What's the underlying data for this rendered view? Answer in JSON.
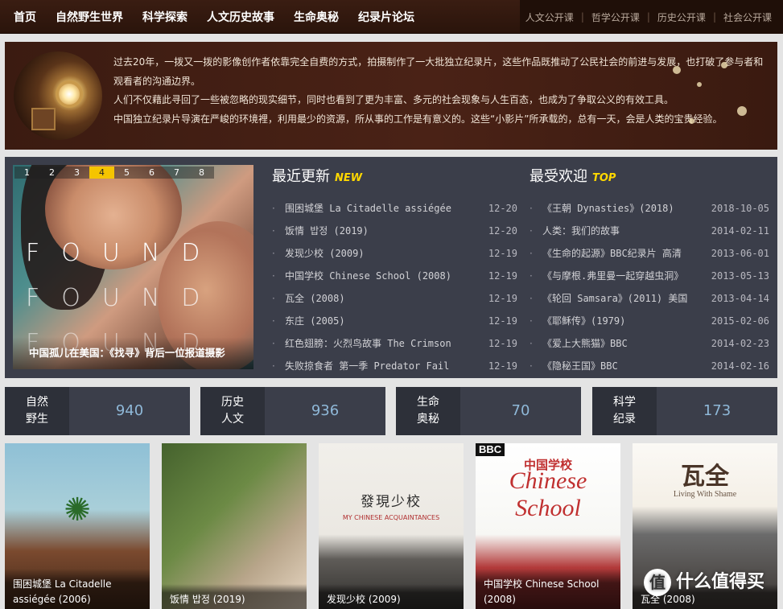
{
  "nav": {
    "main": [
      "首页",
      "自然野生世界",
      "科学探索",
      "人文历史故事",
      "生命奥秘",
      "纪录片论坛"
    ],
    "sub": [
      "人文公开课",
      "哲学公开课",
      "历史公开课",
      "社会公开课"
    ]
  },
  "intro": {
    "paragraphs": [
      "过去20年，一拨又一拨的影像创作者依靠完全自费的方式，拍摄制作了一大批独立纪录片，这些作品既推动了公民社会的前进与发展，也打破了参与者和观看者的沟通边界。",
      "人们不仅藉此寻回了一些被忽略的现实细节，同时也看到了更为丰富、多元的社会现象与人生百态，也成为了争取公义的有效工具。",
      "中国独立纪录片导演在严峻的环境裡，利用最少的资源，所从事的工作是有意义的。这些“小影片”所承载的，总有一天，会是人类的宝贵经验。"
    ]
  },
  "slider": {
    "pages": [
      "1",
      "2",
      "3",
      "4",
      "5",
      "6",
      "7",
      "8"
    ],
    "active_page": "4",
    "overlay_words": [
      "FOUND",
      "FOUND",
      "FOUND"
    ],
    "caption": "中国孤儿在美国：《找寻》背后一位报道摄影"
  },
  "latest": {
    "title": "最近更新",
    "tag": "NEW",
    "items": [
      {
        "title": "围困城堡 La Citadelle assiégée",
        "date": "12-20"
      },
      {
        "title": "饭情 밥정 (2019)",
        "date": "12-20"
      },
      {
        "title": "发现少校 (2009)",
        "date": "12-19"
      },
      {
        "title": "中国学校 Chinese School (2008)",
        "date": "12-19"
      },
      {
        "title": "瓦全 (2008)",
        "date": "12-19"
      },
      {
        "title": "东庄 (2005)",
        "date": "12-19"
      },
      {
        "title": "红色翅膀：火烈鸟故事 The Crimson",
        "date": "12-19"
      },
      {
        "title": "失败掠食者 第一季 Predator Fail",
        "date": "12-19"
      }
    ]
  },
  "popular": {
    "title": "最受欢迎",
    "tag": "TOP",
    "items": [
      {
        "title": "《王朝 Dynasties》(2018)",
        "date": "2018-10-05"
      },
      {
        "title": "人类：我们的故事",
        "date": "2014-02-11"
      },
      {
        "title": "《生命的起源》BBC纪录片 高清",
        "date": "2013-06-01"
      },
      {
        "title": "《与摩根.弗里曼一起穿越虫洞》",
        "date": "2013-05-13"
      },
      {
        "title": "《轮回 Samsara》(2011) 美国",
        "date": "2013-04-14"
      },
      {
        "title": "《耶稣传》(1979)",
        "date": "2015-02-06"
      },
      {
        "title": "《爱上大熊猫》BBC",
        "date": "2014-02-23"
      },
      {
        "title": "《隐秘王国》BBC",
        "date": "2014-02-16"
      }
    ]
  },
  "stats": [
    {
      "label1": "自然",
      "label2": "野生",
      "count": "940"
    },
    {
      "label1": "历史",
      "label2": "人文",
      "count": "936"
    },
    {
      "label1": "生命",
      "label2": "奥秘",
      "count": "70"
    },
    {
      "label1": "科学",
      "label2": "纪录",
      "count": "173"
    }
  ],
  "posters": [
    {
      "caption": "围困城堡 La Citadelle assiégée (2006)"
    },
    {
      "caption": "饭情 밥정 (2019)"
    },
    {
      "caption": "发现少校 (2009)",
      "art_title": "發現少校",
      "art_sub": "MY CHINESE ACQUAINTANCES"
    },
    {
      "caption": "中国学校 Chinese School (2008)",
      "art_brand": "BBC",
      "art_cn": "中国学校",
      "art_en1": "Chinese",
      "art_en2": "School"
    },
    {
      "caption": "瓦全 (2008)",
      "art_title": "瓦全",
      "art_sub": "Living With Shame"
    }
  ],
  "watermark": {
    "badge": "值",
    "text": "什么值得买"
  }
}
